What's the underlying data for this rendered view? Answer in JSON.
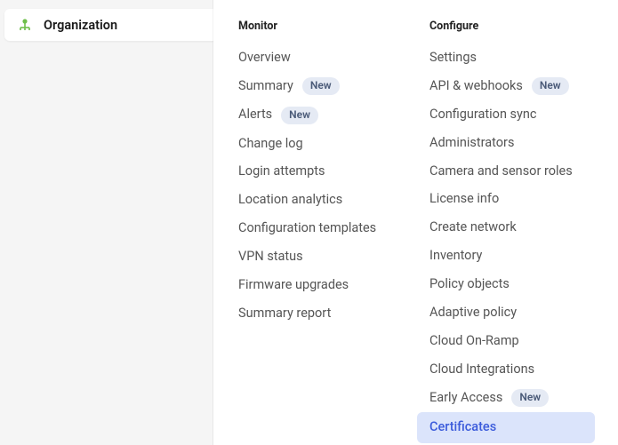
{
  "sidebar": {
    "label": "Organization"
  },
  "menu": {
    "monitor": {
      "header": "Monitor",
      "items": [
        {
          "label": "Overview",
          "badge": null
        },
        {
          "label": "Summary",
          "badge": "New"
        },
        {
          "label": "Alerts",
          "badge": "New"
        },
        {
          "label": "Change log",
          "badge": null
        },
        {
          "label": "Login attempts",
          "badge": null
        },
        {
          "label": "Location analytics",
          "badge": null
        },
        {
          "label": "Configuration templates",
          "badge": null
        },
        {
          "label": "VPN status",
          "badge": null
        },
        {
          "label": "Firmware upgrades",
          "badge": null
        },
        {
          "label": "Summary report",
          "badge": null
        }
      ]
    },
    "configure": {
      "header": "Configure",
      "items": [
        {
          "label": "Settings",
          "badge": null,
          "highlighted": false
        },
        {
          "label": "API & webhooks",
          "badge": "New",
          "highlighted": false
        },
        {
          "label": "Configuration sync",
          "badge": null,
          "highlighted": false
        },
        {
          "label": "Administrators",
          "badge": null,
          "highlighted": false
        },
        {
          "label": "Camera and sensor roles",
          "badge": null,
          "highlighted": false
        },
        {
          "label": "License info",
          "badge": null,
          "highlighted": false
        },
        {
          "label": "Create network",
          "badge": null,
          "highlighted": false
        },
        {
          "label": "Inventory",
          "badge": null,
          "highlighted": false
        },
        {
          "label": "Policy objects",
          "badge": null,
          "highlighted": false
        },
        {
          "label": "Adaptive policy",
          "badge": null,
          "highlighted": false
        },
        {
          "label": "Cloud On-Ramp",
          "badge": null,
          "highlighted": false
        },
        {
          "label": "Cloud Integrations",
          "badge": null,
          "highlighted": false
        },
        {
          "label": "Early Access",
          "badge": "New",
          "highlighted": false
        },
        {
          "label": "Certificates",
          "badge": null,
          "highlighted": true
        }
      ]
    }
  }
}
